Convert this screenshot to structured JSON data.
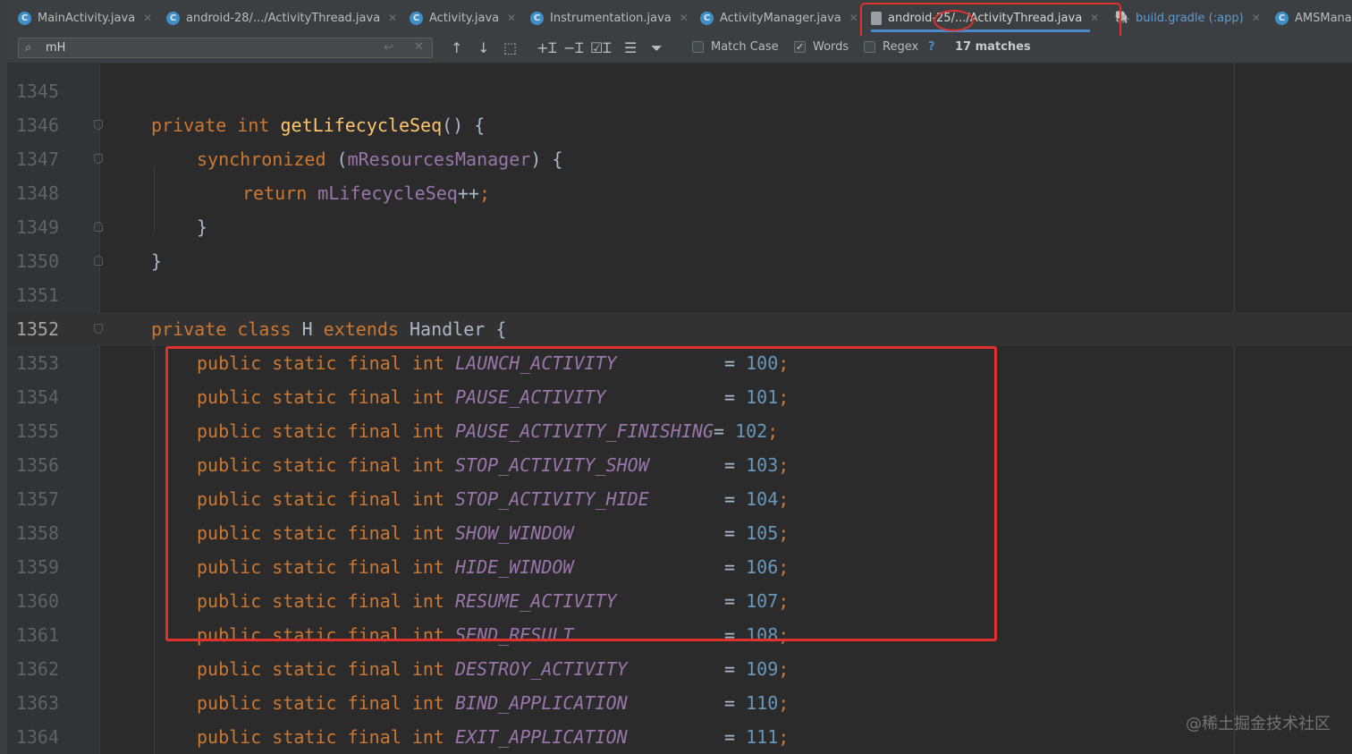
{
  "tabs": [
    {
      "label": "MainActivity.java",
      "icon": "java-class-icon"
    },
    {
      "label": "android-28/.../ActivityThread.java",
      "icon": "java-class-icon"
    },
    {
      "label": "Activity.java",
      "icon": "java-class-icon"
    },
    {
      "label": "Instrumentation.java",
      "icon": "java-class-icon"
    },
    {
      "label": "ActivityManager.java",
      "icon": "java-class-icon"
    },
    {
      "label": "android-25/.../ActivityThread.java",
      "icon": "java-file-icon"
    },
    {
      "label": "build.gradle (:app)",
      "icon": "gradle-icon"
    },
    {
      "label": "AMSMana",
      "icon": "java-class-icon"
    }
  ],
  "active_tab": "android-25/.../ActivityThread.java",
  "find": {
    "query": "mH",
    "match_case": {
      "label": "Match Case",
      "checked": false
    },
    "words": {
      "label": "Words",
      "checked": true
    },
    "regex": {
      "label": "Regex",
      "checked": false
    },
    "regex_help": "?",
    "matches": "17 matches"
  },
  "editor": {
    "lines": [
      {
        "num": "1345",
        "code": ""
      },
      {
        "num": "1346",
        "code": "private int getLifecycleSeq() {"
      },
      {
        "num": "1347",
        "code": "synchronized (mResourcesManager) {"
      },
      {
        "num": "1348",
        "code": "return mLifecycleSeq++;"
      },
      {
        "num": "1349",
        "code": "}"
      },
      {
        "num": "1350",
        "code": "}"
      },
      {
        "num": "1351",
        "code": ""
      },
      {
        "num": "1352",
        "code": "private class H extends Handler {"
      },
      {
        "num": "1353",
        "const": "LAUNCH_ACTIVITY",
        "pad": "          ",
        "value": "100"
      },
      {
        "num": "1354",
        "const": "PAUSE_ACTIVITY",
        "pad": "           ",
        "value": "101"
      },
      {
        "num": "1355",
        "const": "PAUSE_ACTIVITY_FINISHING",
        "pad": "",
        "value": "102"
      },
      {
        "num": "1356",
        "const": "STOP_ACTIVITY_SHOW",
        "pad": "       ",
        "value": "103"
      },
      {
        "num": "1357",
        "const": "STOP_ACTIVITY_HIDE",
        "pad": "       ",
        "value": "104"
      },
      {
        "num": "1358",
        "const": "SHOW_WINDOW",
        "pad": "              ",
        "value": "105"
      },
      {
        "num": "1359",
        "const": "HIDE_WINDOW",
        "pad": "              ",
        "value": "106"
      },
      {
        "num": "1360",
        "const": "RESUME_ACTIVITY",
        "pad": "          ",
        "value": "107"
      },
      {
        "num": "1361",
        "const": "SEND_RESULT",
        "pad": "              ",
        "value": "108"
      },
      {
        "num": "1362",
        "const": "DESTROY_ACTIVITY",
        "pad": "         ",
        "value": "109"
      },
      {
        "num": "1363",
        "const": "BIND_APPLICATION",
        "pad": "         ",
        "value": "110"
      },
      {
        "num": "1364",
        "const": "EXIT_APPLICATION",
        "pad": "         ",
        "value": "111"
      }
    ],
    "const_prefix": "public static final int",
    "current_line": "1352"
  },
  "watermark": "@稀土掘金技术社区",
  "colors": {
    "highlight_red": "#e0322c",
    "keyword": "#cc7832",
    "method": "#ffc66d",
    "field": "#9876aa",
    "number": "#6897bb"
  }
}
